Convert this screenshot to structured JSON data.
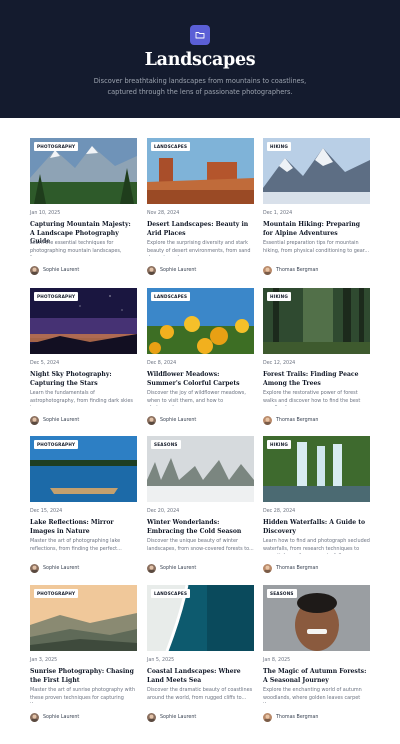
{
  "hero": {
    "icon": "folder-icon",
    "title": "Landscapes",
    "subtitle": "Discover breathtaking landscapes from mountains to coastlines, captured through the lens of passionate photographers."
  },
  "colors": {
    "hero_bg": "#141b2e",
    "accent": "#5b5fd6"
  },
  "posts": [
    {
      "category": "PHOTOGRAPHY",
      "date": "Jan 10, 2025",
      "title": "Capturing Mountain Majesty: A Landscape Photography Guide",
      "excerpt": "Learn the essential techniques for photographing mountain landscapes, from...",
      "author": "Sophie Laurent"
    },
    {
      "category": "LANDSCAPES",
      "date": "Nov 28, 2024",
      "title": "Desert Landscapes: Beauty in Arid Places",
      "excerpt": "Explore the surprising diversity and stark beauty of desert environments, from sand dunes to rocky canyons.",
      "author": "Sophie Laurent"
    },
    {
      "category": "HIKING",
      "date": "Dec 1, 2024",
      "title": "Mountain Hiking: Preparing for Alpine Adventures",
      "excerpt": "Essential preparation tips for mountain hiking, from physical conditioning to gear...",
      "author": "Thomas Bergman"
    },
    {
      "category": "PHOTOGRAPHY",
      "date": "Dec 5, 2024",
      "title": "Night Sky Photography: Capturing the Stars",
      "excerpt": "Learn the fundamentals of astrophotography, from finding dark skies t...",
      "author": "Sophie Laurent"
    },
    {
      "category": "LANDSCAPES",
      "date": "Dec 8, 2024",
      "title": "Wildflower Meadows: Summer's Colorful Carpets",
      "excerpt": "Discover the joy of wildflower meadows, when to visit them, and how to photograph...",
      "author": "Sophie Laurent"
    },
    {
      "category": "HIKING",
      "date": "Dec 12, 2024",
      "title": "Forest Trails: Finding Peace Among the Trees",
      "excerpt": "Explore the restorative power of forest walks and discover how to find the best woodland...",
      "author": "Thomas Bergman"
    },
    {
      "category": "PHOTOGRAPHY",
      "date": "Dec 15, 2024",
      "title": "Lake Reflections: Mirror Images in Nature",
      "excerpt": "Master the art of photographing lake reflections, from finding the perfect...",
      "author": "Sophie Laurent"
    },
    {
      "category": "SEASONS",
      "date": "Dec 20, 2024",
      "title": "Winter Wonderlands: Embracing the Cold Season",
      "excerpt": "Discover the unique beauty of winter landscapes, from snow-covered forests to...",
      "author": "Sophie Laurent"
    },
    {
      "category": "HIKING",
      "date": "Dec 28, 2024",
      "title": "Hidden Waterfalls: A Guide to Discovery",
      "excerpt": "Learn how to find and photograph secluded waterfalls, from research techniques to essential gear for your waterfall adventures.",
      "author": "Thomas Bergman"
    },
    {
      "category": "PHOTOGRAPHY",
      "date": "Jan 3, 2025",
      "title": "Sunrise Photography: Chasing the First Light",
      "excerpt": "Master the art of sunrise photography with these proven techniques for capturing the...",
      "author": "Sophie Laurent"
    },
    {
      "category": "LANDSCAPES",
      "date": "Jan 5, 2025",
      "title": "Coastal Landscapes: Where Land Meets Sea",
      "excerpt": "Discover the dramatic beauty of coastlines around the world, from rugged cliffs to...",
      "author": "Sophie Laurent"
    },
    {
      "category": "SEASONS",
      "date": "Jan 8, 2025",
      "title": "The Magic of Autumn Forests: A Seasonal Journey",
      "excerpt": "Explore the enchanting world of autumn woodlands, where golden leaves carpet the...",
      "author": "Thomas Bergman"
    }
  ]
}
